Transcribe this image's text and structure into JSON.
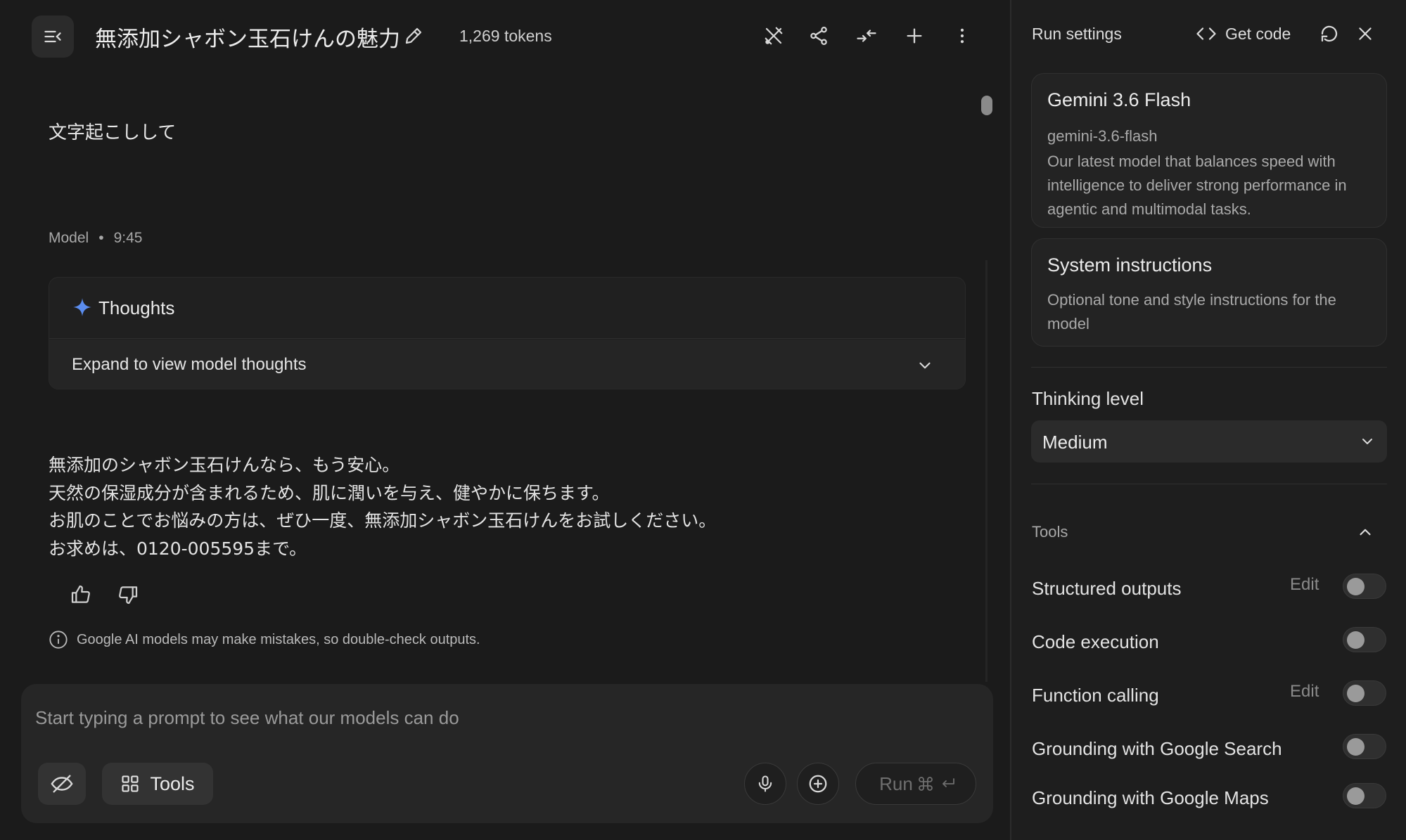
{
  "chat": {
    "title": "無添加シャボン玉石けんの魅力",
    "token_count": "1,269 tokens",
    "user_message": "文字起こしして",
    "model_label": "Model",
    "model_time": "9:45",
    "thoughts_title": "Thoughts",
    "thoughts_expand": "Expand to view model thoughts",
    "answer_lines": [
      "無添加のシャボン玉石けんなら、もう安心。",
      "天然の保湿成分が含まれるため、肌に潤いを与え、健やかに保ちます。",
      "お肌のことでお悩みの方は、ぜひ一度、無添加シャボン玉石けんをお試しください。",
      "お求めは、0120-005595まで。"
    ],
    "disclaimer": "Google AI models may make mistakes, so double-check outputs."
  },
  "composer": {
    "placeholder": "Start typing a prompt to see what our models can do",
    "tools_label": "Tools",
    "run_label": "Run"
  },
  "settings": {
    "title": "Run settings",
    "get_code": "Get code",
    "model": {
      "name": "Gemini 3.6 Flash",
      "id": "gemini-3.6-flash",
      "description": "Our latest model that balances speed with intelligence to deliver strong performance in agentic and multimodal tasks."
    },
    "system_instructions": {
      "title": "System instructions",
      "placeholder": "Optional tone and style instructions for the model"
    },
    "thinking_level": {
      "label": "Thinking level",
      "value": "Medium"
    },
    "tools_label": "Tools",
    "tools": [
      {
        "name": "Structured outputs",
        "edit": "Edit",
        "enabled": false
      },
      {
        "name": "Code execution",
        "edit": "",
        "enabled": false
      },
      {
        "name": "Function calling",
        "edit": "Edit",
        "enabled": false
      },
      {
        "name": "Grounding with Google Search",
        "edit": "",
        "enabled": false
      },
      {
        "name": "Grounding with Google Maps",
        "edit": "",
        "enabled": false
      }
    ]
  },
  "colors": {
    "background": "#1b1b1b",
    "panel": "#1e1e1e",
    "accent_spark": "#5b8def"
  }
}
